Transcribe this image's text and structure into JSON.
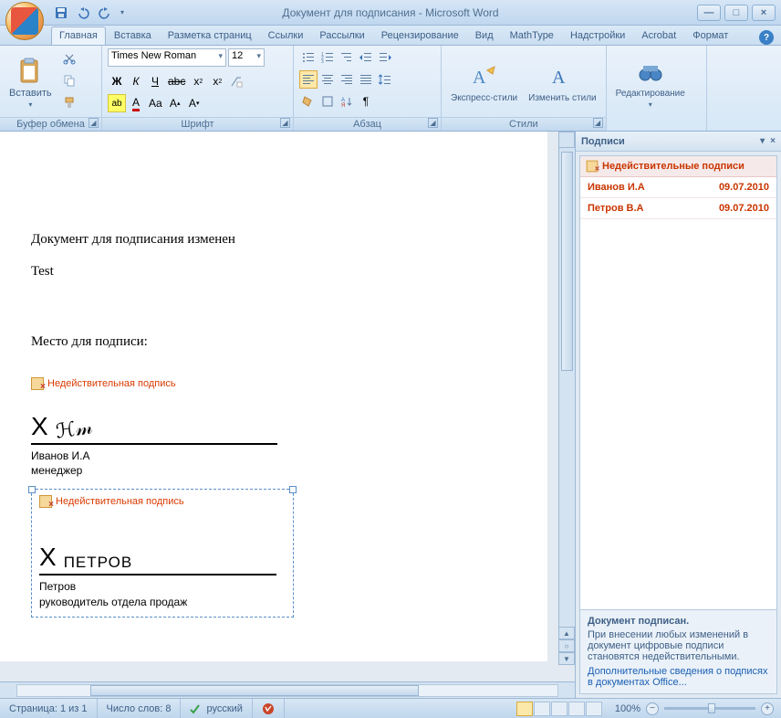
{
  "title": "Документ для подписания - Microsoft Word",
  "tabs": [
    "Главная",
    "Вставка",
    "Разметка страниц",
    "Ссылки",
    "Рассылки",
    "Рецензирование",
    "Вид",
    "MathType",
    "Надстройки",
    "Acrobat",
    "Формат"
  ],
  "active_tab": 0,
  "ribbon": {
    "clipboard": {
      "label": "Буфер обмена",
      "paste": "Вставить"
    },
    "font": {
      "label": "Шрифт",
      "name": "Times New Roman",
      "size": "12"
    },
    "paragraph": {
      "label": "Абзац"
    },
    "styles": {
      "label": "Стили",
      "quick": "Экспресс-стили",
      "change": "Изменить стили"
    },
    "editing": {
      "label": "Редактирование"
    }
  },
  "document": {
    "line1": "Документ для подписания изменен",
    "line2": "Test",
    "heading": "Место для подписи:",
    "sig1": {
      "warn": "Недействительная подпись",
      "name": "Иванов И.А",
      "role": "менеджер"
    },
    "sig2": {
      "warn": "Недействительная подпись",
      "typed": "ПЕТРОВ",
      "name": "Петров",
      "role": "руководитель отдела продаж"
    }
  },
  "task_pane": {
    "title": "Подписи",
    "invalid_header": "Недействительные подписи",
    "rows": [
      {
        "name": "Иванов И.А",
        "date": "09.07.2010"
      },
      {
        "name": "Петров В.А",
        "date": "09.07.2010"
      }
    ],
    "signed": "Документ подписан.",
    "info": "При внесении любых изменений в документ цифровые подписи становятся недействительными.",
    "link": "Дополнительные сведения о подписях в документах Office..."
  },
  "status": {
    "page": "Страница: 1 из 1",
    "words": "Число слов: 8",
    "lang": "русский",
    "zoom": "100%"
  }
}
